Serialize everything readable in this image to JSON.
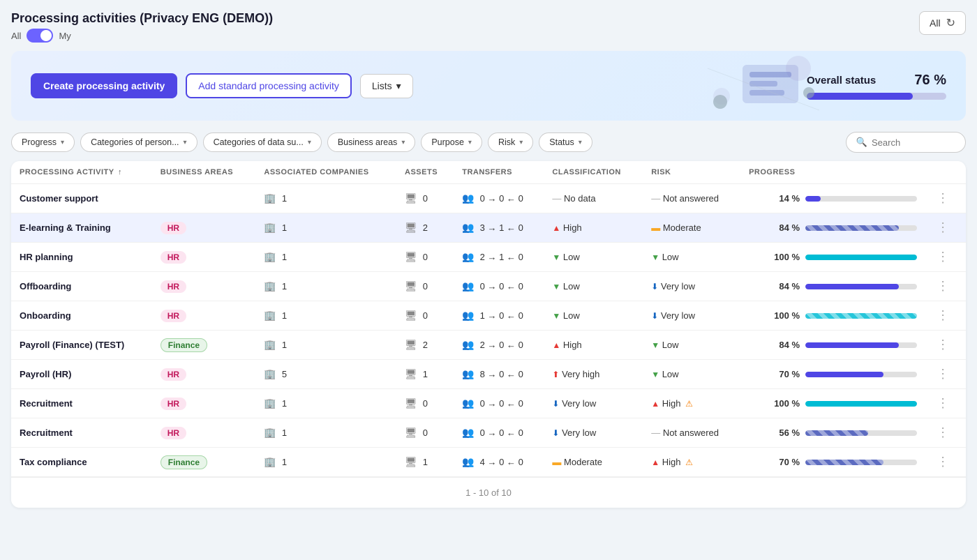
{
  "header": {
    "title": "Processing activities (Privacy ENG (DEMO))",
    "toggle_all": "All",
    "toggle_my": "My",
    "dropdown_all": "All"
  },
  "banner": {
    "btn_create": "Create processing activity",
    "btn_add_standard": "Add standard processing activity",
    "btn_lists": "Lists",
    "overall_label": "Overall status",
    "overall_pct": "76 %",
    "overall_bar_pct": 76
  },
  "filters": [
    {
      "id": "progress",
      "label": "Progress"
    },
    {
      "id": "categories_person",
      "label": "Categories of person..."
    },
    {
      "id": "categories_data",
      "label": "Categories of data su..."
    },
    {
      "id": "business_areas",
      "label": "Business areas"
    },
    {
      "id": "purpose",
      "label": "Purpose"
    },
    {
      "id": "risk",
      "label": "Risk"
    },
    {
      "id": "status",
      "label": "Status"
    }
  ],
  "search_placeholder": "Search",
  "table": {
    "columns": [
      "Processing activity",
      "Business areas",
      "Associated companies",
      "Assets",
      "Transfers",
      "Classification",
      "Risk",
      "Progress"
    ],
    "rows": [
      {
        "name": "Customer support",
        "tag": null,
        "tag_type": null,
        "companies": "1",
        "assets": "0",
        "transfers": "0 → 0 ← 0",
        "classification_dash": true,
        "classification_label": "No data",
        "risk_arrow": "dash",
        "risk_label": "Not answered",
        "progress_pct": 14,
        "progress_label": "14 %",
        "progress_type": "solid-blue",
        "highlighted": false
      },
      {
        "name": "E-learning & Training",
        "tag": "HR",
        "tag_type": "hr",
        "companies": "1",
        "assets": "2",
        "transfers": "3 → 1 ← 0",
        "classification_dash": false,
        "classification_arrow": "up",
        "classification_label": "High",
        "risk_arrow": "moderate",
        "risk_label": "Moderate",
        "progress_pct": 84,
        "progress_label": "84 %",
        "progress_type": "striped-blue",
        "highlighted": true
      },
      {
        "name": "HR planning",
        "tag": "HR",
        "tag_type": "hr",
        "companies": "1",
        "assets": "0",
        "transfers": "2 → 1 ← 0",
        "classification_dash": false,
        "classification_arrow": "down",
        "classification_label": "Low",
        "risk_arrow": "down",
        "risk_label": "Low",
        "progress_pct": 100,
        "progress_label": "100 %",
        "progress_type": "solid-teal",
        "highlighted": false
      },
      {
        "name": "Offboarding",
        "tag": "HR",
        "tag_type": "hr",
        "companies": "1",
        "assets": "0",
        "transfers": "0 → 0 ← 0",
        "classification_dash": false,
        "classification_arrow": "down",
        "classification_label": "Low",
        "risk_arrow": "vlow",
        "risk_label": "Very low",
        "progress_pct": 84,
        "progress_label": "84 %",
        "progress_type": "solid-blue",
        "highlighted": false
      },
      {
        "name": "Onboarding",
        "tag": "HR",
        "tag_type": "hr",
        "companies": "1",
        "assets": "0",
        "transfers": "1 → 0 ← 0",
        "classification_dash": false,
        "classification_arrow": "down",
        "classification_label": "Low",
        "risk_arrow": "vlow",
        "risk_label": "Very low",
        "progress_pct": 100,
        "progress_label": "100 %",
        "progress_type": "striped-teal",
        "highlighted": false
      },
      {
        "name": "Payroll (Finance) (TEST)",
        "tag": "Finance",
        "tag_type": "finance",
        "companies": "1",
        "assets": "2",
        "transfers": "2 → 0 ← 0",
        "classification_dash": false,
        "classification_arrow": "up",
        "classification_label": "High",
        "risk_arrow": "down",
        "risk_label": "Low",
        "progress_pct": 84,
        "progress_label": "84 %",
        "progress_type": "solid-blue",
        "highlighted": false
      },
      {
        "name": "Payroll (HR)",
        "tag": "HR",
        "tag_type": "hr",
        "companies": "5",
        "assets": "1",
        "transfers": "8 → 0 ← 0",
        "classification_dash": false,
        "classification_arrow": "vhigh",
        "classification_label": "Very high",
        "risk_arrow": "down",
        "risk_label": "Low",
        "progress_pct": 70,
        "progress_label": "70 %",
        "progress_type": "solid-blue",
        "highlighted": false
      },
      {
        "name": "Recruitment",
        "tag": "HR",
        "tag_type": "hr",
        "companies": "1",
        "assets": "0",
        "transfers": "0 → 0 ← 0",
        "classification_dash": false,
        "classification_arrow": "vlow",
        "classification_label": "Very low",
        "risk_arrow": "up",
        "risk_label": "High",
        "risk_warning": true,
        "progress_pct": 100,
        "progress_label": "100 %",
        "progress_type": "solid-teal",
        "highlighted": false
      },
      {
        "name": "Recruitment",
        "tag": "HR",
        "tag_type": "hr",
        "companies": "1",
        "assets": "0",
        "transfers": "0 → 0 ← 0",
        "classification_dash": false,
        "classification_arrow": "vlow",
        "classification_label": "Very low",
        "risk_arrow": "dash",
        "risk_label": "Not answered",
        "progress_pct": 56,
        "progress_label": "56 %",
        "progress_type": "striped-blue",
        "highlighted": false
      },
      {
        "name": "Tax compliance",
        "tag": "Finance",
        "tag_type": "finance",
        "companies": "1",
        "assets": "1",
        "transfers": "4 → 0 ← 0",
        "classification_dash": false,
        "classification_arrow": "moderate",
        "classification_label": "Moderate",
        "risk_arrow": "up",
        "risk_label": "High",
        "risk_warning": true,
        "progress_pct": 70,
        "progress_label": "70 %",
        "progress_type": "striped-blue",
        "highlighted": false
      }
    ],
    "pagination": "1 - 10 of 10"
  }
}
